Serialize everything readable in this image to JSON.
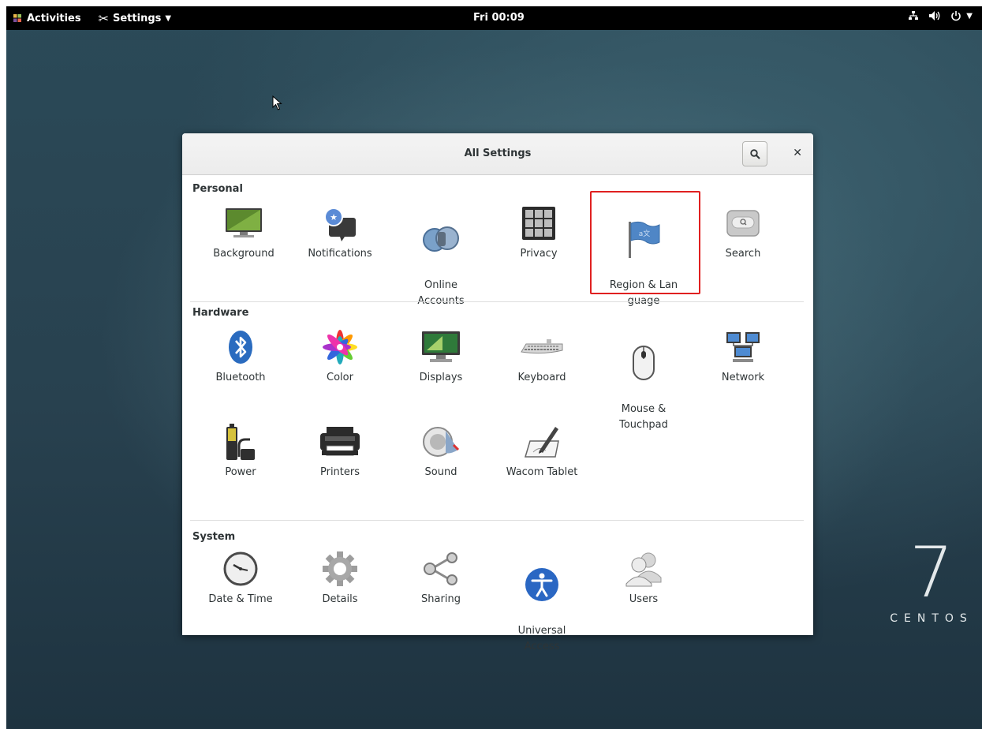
{
  "topbar": {
    "activities_label": "Activities",
    "app_menu_label": "Settings",
    "clock": "Fri 00:09",
    "status_icons": [
      "network-icon",
      "volume-icon",
      "power-icon"
    ]
  },
  "window": {
    "title": "All Settings",
    "sections": {
      "personal": "Personal",
      "hardware": "Hardware",
      "system": "System"
    },
    "items": {
      "background": "Background",
      "notifications": "Notifications",
      "online_accounts": "Online\nAccounts",
      "privacy": "Privacy",
      "region_language": "Region & Lan\nguage",
      "search": "Search",
      "bluetooth": "Bluetooth",
      "color": "Color",
      "displays": "Displays",
      "keyboard": "Keyboard",
      "mouse_touchpad": "Mouse &\nTouchpad",
      "network": "Network",
      "power": "Power",
      "printers": "Printers",
      "sound": "Sound",
      "wacom_tablet": "Wacom Tablet",
      "date_time": "Date & Time",
      "details": "Details",
      "sharing": "Sharing",
      "universal_access": "Universal\nAccess",
      "users": "Users"
    }
  },
  "brand": {
    "number": "7",
    "name": "CENTOS"
  },
  "colors": {
    "highlight": "#e02020",
    "topbar": "#000000"
  }
}
